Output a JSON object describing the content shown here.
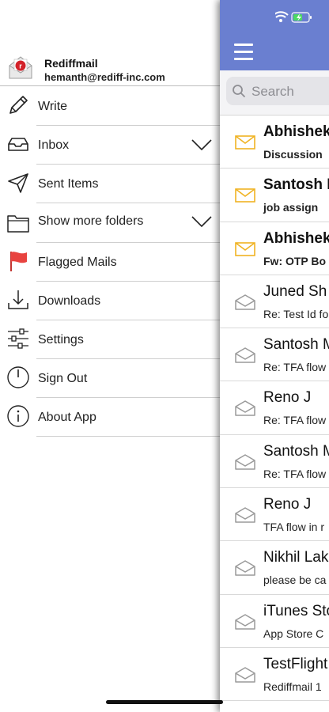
{
  "account": {
    "name": "Rediffmail",
    "email": "hemanth@rediff-inc.com"
  },
  "menu": [
    {
      "label": "Write",
      "icon": "pencil-icon"
    },
    {
      "label": "Inbox",
      "icon": "inbox-tray-icon",
      "chevron": true
    },
    {
      "label": "Sent Items",
      "icon": "paper-plane-icon"
    },
    {
      "label": "Show more folders",
      "icon": "folder-icon",
      "chevron": true
    },
    {
      "label": "Flagged Mails",
      "icon": "red-flag-icon"
    },
    {
      "label": "Downloads",
      "icon": "download-icon"
    },
    {
      "label": "Settings",
      "icon": "sliders-icon"
    },
    {
      "label": "Sign Out",
      "icon": "power-icon"
    },
    {
      "label": "About App",
      "icon": "info-icon"
    }
  ],
  "search": {
    "placeholder": "Search"
  },
  "mails": [
    {
      "sender": "Abhishek",
      "subject": "Discussion",
      "unread": true
    },
    {
      "sender": "Santosh I",
      "subject": "job assign",
      "unread": true
    },
    {
      "sender": "Abhishek",
      "subject": "Fw: OTP Bo",
      "unread": true
    },
    {
      "sender": "Juned Sh",
      "subject": "Re: Test Id fo",
      "unread": false
    },
    {
      "sender": "Santosh M",
      "subject": "Re: TFA flow",
      "unread": false
    },
    {
      "sender": "Reno J",
      "subject": "Re: TFA flow",
      "unread": false
    },
    {
      "sender": "Santosh M",
      "subject": "Re: TFA flow",
      "unread": false
    },
    {
      "sender": "Reno J",
      "subject": "TFA flow in r",
      "unread": false
    },
    {
      "sender": "Nikhil Lak",
      "subject": "please be ca",
      "unread": false
    },
    {
      "sender": "iTunes Sto",
      "subject": "App Store C",
      "unread": false
    },
    {
      "sender": "TestFlight",
      "subject": "Rediffmail 1",
      "unread": false
    }
  ],
  "colors": {
    "topbar": "#6a7fd0",
    "unread_envelope": "#f0b323",
    "read_envelope": "#9a9a9a",
    "flag": "#e8433f",
    "battery": "#4cd964"
  }
}
